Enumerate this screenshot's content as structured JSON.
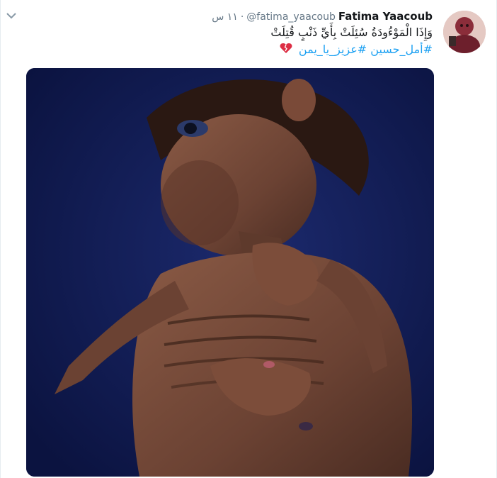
{
  "tweet": {
    "author_name": "Fatima Yaacoub",
    "author_handle": "@fatima_yaacoub",
    "dot": "·",
    "time": "١١ س",
    "text_line1": "وَإِذَا الْمَوْءُودَةُ سُئِلَتْ بِأَيِّ ذَنْبٍ قُتِلَتْ",
    "hashtag1": "#أمل_حسين",
    "hashtag2": "#عزيز_يا_يمن"
  },
  "icons": {
    "more": "chevron-down-icon",
    "heart": "broken-heart-icon"
  },
  "colors": {
    "link": "#1da1f2",
    "text": "#14171a",
    "secondary": "#657786",
    "media_background": "#101c55"
  }
}
